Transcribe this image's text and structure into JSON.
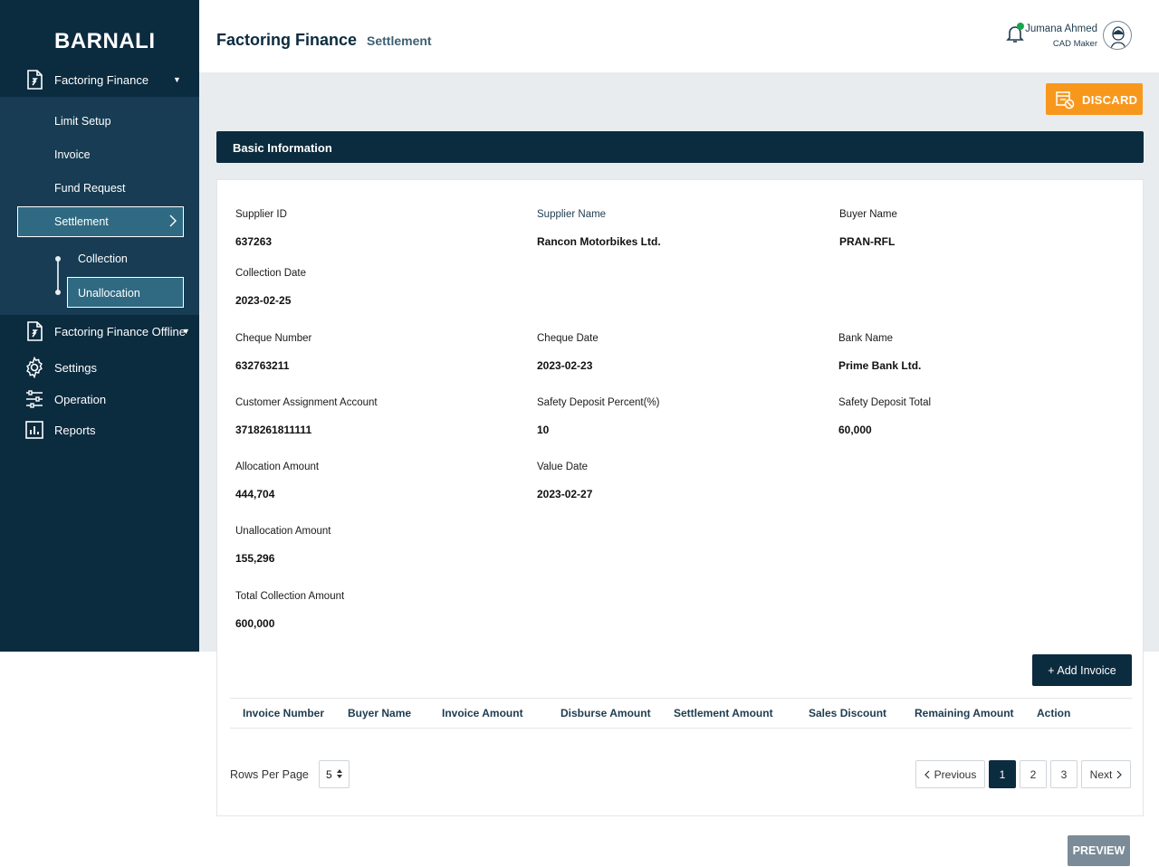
{
  "app": {
    "brand": "BARNALI"
  },
  "sidebar": {
    "factoring_finance": "Factoring Finance",
    "sub_items": {
      "limit_setup": "Limit Setup",
      "invoice": "Invoice",
      "fund_request": "Fund Request",
      "settlement": "Settlement"
    },
    "settlement_children": {
      "collection": "Collection",
      "unallocation": "Unallocation"
    },
    "factoring_finance_offline": "Factoring Finance Offline",
    "settings": "Settings",
    "operation": "Operation",
    "reports": "Reports"
  },
  "header": {
    "title": "Factoring Finance",
    "subtitle": "Settlement",
    "user_name": "Jumana Ahmed",
    "user_role": "CAD Maker"
  },
  "actions": {
    "discard": "DISCARD",
    "add_invoice": "+ Add Invoice",
    "preview": "PREVIEW"
  },
  "section": {
    "title": "Basic Information"
  },
  "fields": {
    "supplier_id": {
      "label": "Supplier ID",
      "value": "637263"
    },
    "supplier_name": {
      "label": "Supplier Name",
      "value": "Rancon Motorbikes Ltd."
    },
    "buyer_name": {
      "label": "Buyer Name",
      "value": "PRAN-RFL"
    },
    "collection_date": {
      "label": "Collection Date",
      "value": "2023-02-25"
    },
    "cheque_number": {
      "label": "Cheque Number",
      "value": "632763211"
    },
    "cheque_date": {
      "label": "Cheque Date",
      "value": "2023-02-23"
    },
    "bank_name": {
      "label": "Bank Name",
      "value": "Prime Bank Ltd."
    },
    "customer_assignment_account": {
      "label": "Customer Assignment Account",
      "value": "3718261811111"
    },
    "safety_deposit_percent": {
      "label": "Safety Deposit Percent(%)",
      "value": "10"
    },
    "safety_deposit_total": {
      "label": "Safety Deposit Total",
      "value": "60,000"
    },
    "allocation_amount": {
      "label": "Allocation Amount",
      "value": "444,704"
    },
    "value_date": {
      "label": "Value Date",
      "value": "2023-02-27"
    },
    "unallocation_amount": {
      "label": "Unallocation Amount",
      "value": "155,296"
    },
    "total_collection_amount": {
      "label": "Total Collection Amount",
      "value": "600,000"
    }
  },
  "table": {
    "columns": [
      "Invoice Number",
      "Buyer Name",
      "Invoice Amount",
      "Disburse Amount",
      "Settlement Amount",
      "Sales Discount",
      "Remaining Amount",
      "Action"
    ]
  },
  "pagination": {
    "rows_per_page_label": "Rows Per Page",
    "rows_per_page_value": "5",
    "previous": "Previous",
    "pages": [
      "1",
      "2",
      "3"
    ],
    "next": "Next"
  },
  "colors": {
    "sidebar": "#0b2b3f",
    "accent_orange": "#f7981d",
    "active_item": "#2f6a82",
    "status_dot": "#1ca34d"
  }
}
